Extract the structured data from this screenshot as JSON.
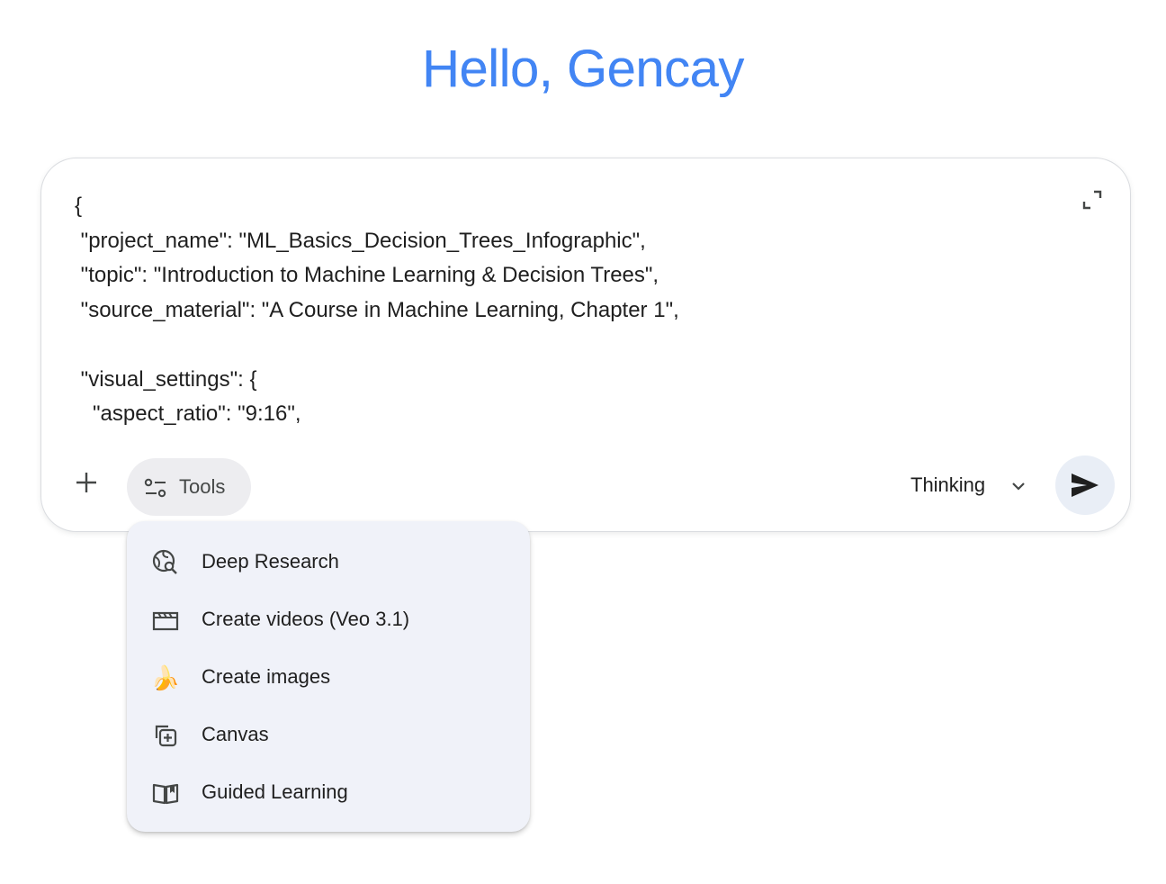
{
  "greeting": "Hello, Gencay",
  "composer": {
    "prompt_text": "{\n \"project_name\": \"ML_Basics_Decision_Trees_Infographic\",\n \"topic\": \"Introduction to Machine Learning & Decision Trees\",\n \"source_material\": \"A Course in Machine Learning, Chapter 1\",\n\n \"visual_settings\": {\n   \"aspect_ratio\": \"9:16\",",
    "expand_icon": "expand-icon",
    "add_icon": "plus-icon",
    "tools_label": "Tools",
    "tools_icon": "tune-icon",
    "mode_label": "Thinking",
    "mode_icon": "chevron-down-icon",
    "send_icon": "send-icon"
  },
  "tools_menu": {
    "items": [
      {
        "label": "Deep Research",
        "icon": "globe-search-icon"
      },
      {
        "label": "Create videos (Veo 3.1)",
        "icon": "movie-clapper-icon"
      },
      {
        "label": "Create images",
        "icon": "banana-icon"
      },
      {
        "label": "Canvas",
        "icon": "canvas-add-icon"
      },
      {
        "label": "Guided Learning",
        "icon": "open-book-icon"
      }
    ]
  },
  "colors": {
    "greeting": "#4285f4",
    "menu_bg": "#f0f2f9",
    "tools_bg": "#ededf0",
    "send_bg": "#e9eef6",
    "text": "#1f1f1f"
  }
}
